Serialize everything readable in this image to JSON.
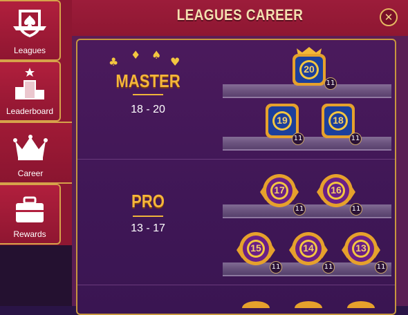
{
  "sidebar": {
    "items": [
      {
        "label": "Leagues",
        "icon": "shield-spades-icon"
      },
      {
        "label": "Leaderboard",
        "icon": "podium-icon"
      },
      {
        "label": "Career",
        "icon": "crown-icon"
      },
      {
        "label": "Rewards",
        "icon": "briefcase-icon"
      }
    ],
    "active": "Career"
  },
  "header": {
    "title": "LEAGUES CAREER",
    "close_icon": "close-icon"
  },
  "leagues": [
    {
      "name": "MASTER",
      "range": "18 - 20",
      "suits": [
        "♣",
        "♦",
        "♠",
        "♥"
      ],
      "badges": [
        {
          "number": "20",
          "level": "11",
          "style": "blue-square-trophy"
        },
        {
          "number": "19",
          "level": "11",
          "style": "blue-square"
        },
        {
          "number": "18",
          "level": "11",
          "style": "blue-square"
        }
      ]
    },
    {
      "name": "PRO",
      "range": "13 - 17",
      "badges": [
        {
          "number": "17",
          "level": "11",
          "style": "purple-chip"
        },
        {
          "number": "16",
          "level": "11",
          "style": "purple-chip"
        },
        {
          "number": "15",
          "level": "11",
          "style": "purple-chip"
        },
        {
          "number": "14",
          "level": "11",
          "style": "purple-chip"
        },
        {
          "number": "13",
          "level": "11",
          "style": "purple-chip"
        }
      ]
    }
  ],
  "colors": {
    "sidebar": "#8e1732",
    "gold": "#f5b63a",
    "panel": "#3f1756",
    "blue_badge": "#1c3f9c",
    "purple_badge": "#6a1f86"
  }
}
